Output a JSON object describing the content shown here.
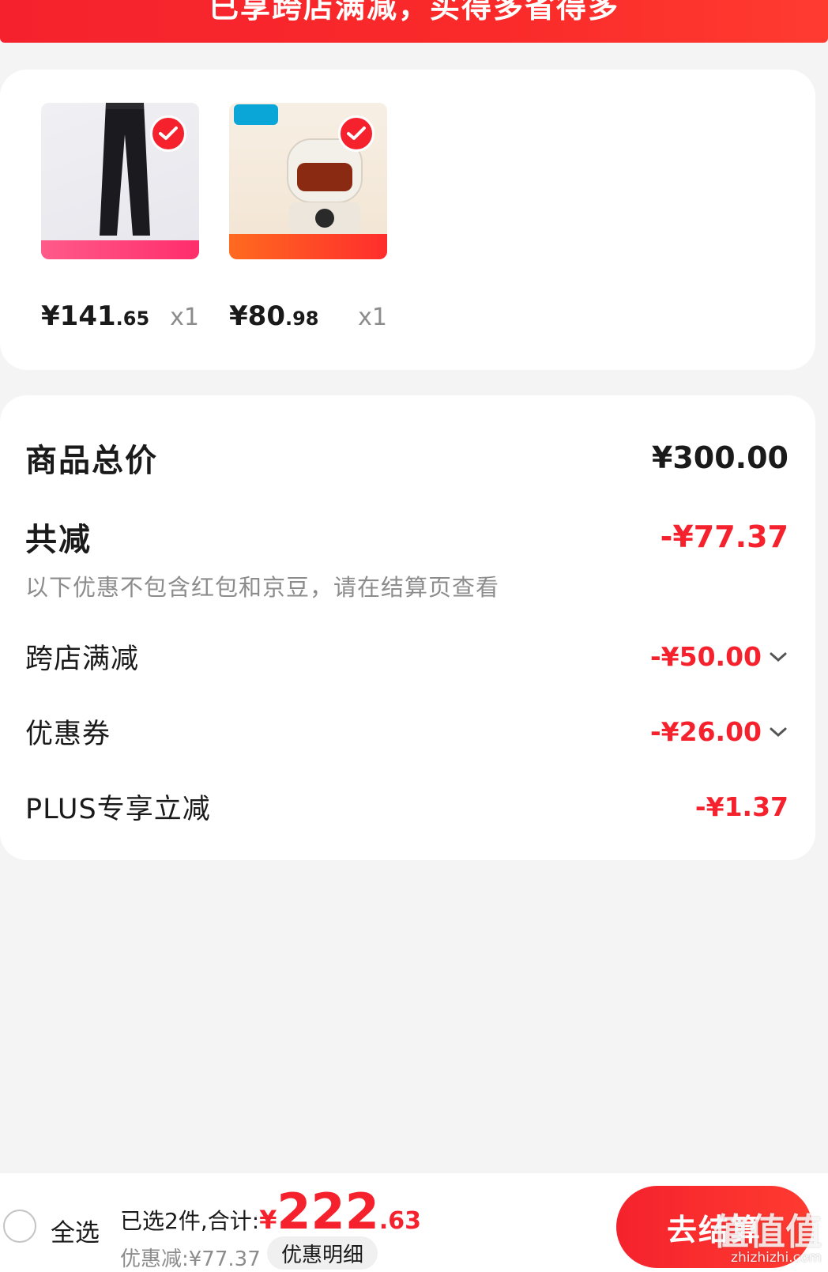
{
  "banner": {
    "text": "已享跨店满减，买得多省得多"
  },
  "products": [
    {
      "price_int": "¥141",
      "price_dec": ".65",
      "qty": "x1"
    },
    {
      "price_int": "¥80",
      "price_dec": ".98",
      "qty": "x1"
    }
  ],
  "summary": {
    "total_label": "商品总价",
    "total_value": "¥300.00",
    "reduce_label": "共减",
    "reduce_value": "-¥77.37",
    "note": "以下优惠不包含红包和京豆，请在结算页查看",
    "items": [
      {
        "label": "跨店满减",
        "value": "-¥50.00"
      },
      {
        "label": "优惠券",
        "value": "-¥26.00"
      },
      {
        "label": "PLUS专享立减",
        "value": "-¥1.37"
      }
    ]
  },
  "bottom": {
    "select_all": "全选",
    "selected_label": "已选2件,合计:",
    "currency": "¥",
    "total_int": "222",
    "total_dec": ".63",
    "discount_line": "优惠减:¥77.37",
    "detail_button": "优惠明细",
    "checkout_button": "去结算"
  },
  "watermark": {
    "big": "值值值",
    "small": "zhizhizhi.com"
  },
  "colors": {
    "accent": "#f5222d",
    "background": "#f4f4f4"
  },
  "icons": [
    "check-icon",
    "chevron-down-icon",
    "radio-icon"
  ]
}
